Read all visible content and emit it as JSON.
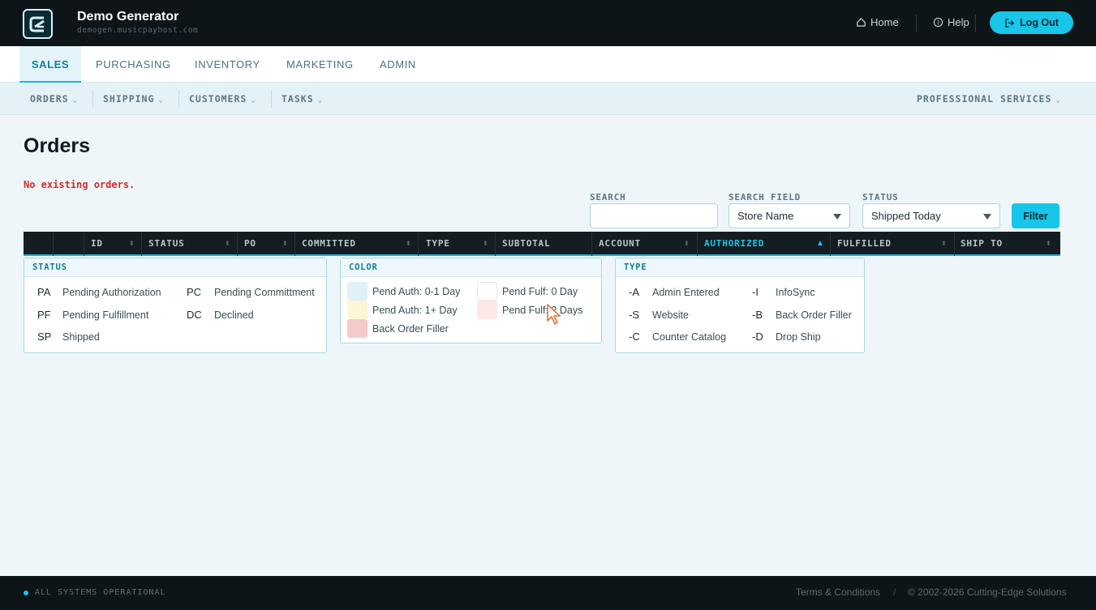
{
  "app": {
    "title": "Demo Generator",
    "subtitle": "demogen.musicpayhost.com"
  },
  "header": {
    "home_label": "Home",
    "help_label": "Help",
    "logout_label": "Log Out"
  },
  "main_tabs": [
    {
      "label": "SALES",
      "active": true
    },
    {
      "label": "PURCHASING",
      "active": false
    },
    {
      "label": "INVENTORY",
      "active": false
    },
    {
      "label": "MARKETING",
      "active": false
    },
    {
      "label": "ADMIN",
      "active": false
    }
  ],
  "sub_nav": {
    "items": [
      "ORDERS",
      "SHIPPING",
      "CUSTOMERS",
      "TASKS"
    ],
    "right_item": "PROFESSIONAL SERVICES"
  },
  "page": {
    "title": "Orders",
    "empty_message": "No existing orders."
  },
  "filters": {
    "search_label": "SEARCH",
    "search_value": "",
    "search_field_label": "SEARCH FIELD",
    "search_field_value": "Store Name",
    "status_label": "STATUS",
    "status_value": "Shipped Today",
    "filter_button": "Filter"
  },
  "table": {
    "columns": [
      "ID",
      "STATUS",
      "PO",
      "COMMITTED",
      "TYPE",
      "SUBTOTAL",
      "ACCOUNT",
      "AUTHORIZED",
      "FULFILLED",
      "SHIP TO"
    ],
    "sorted_column": "AUTHORIZED",
    "sort_direction": "asc"
  },
  "legend": {
    "status": {
      "title": "STATUS",
      "items": [
        {
          "code": "PA",
          "label": "Pending Authorization"
        },
        {
          "code": "PC",
          "label": "Pending Committment"
        },
        {
          "code": "PF",
          "label": "Pending Fulfillment"
        },
        {
          "code": "DC",
          "label": "Declined"
        },
        {
          "code": "SP",
          "label": "Shipped"
        }
      ]
    },
    "color": {
      "title": "COLOR",
      "items": [
        {
          "label": "Pend Auth: 0-1 Day",
          "color": "#e1f0f7"
        },
        {
          "label": "Pend Fulf: 0 Day",
          "color": "#ffffff"
        },
        {
          "label": "Pend Auth: 1+ Day",
          "color": "#fcf6d7"
        },
        {
          "label": "Pend Fulf: 2 Days",
          "color": "#fde7e7"
        },
        {
          "label": "Back Order Filler",
          "color": "#f5caca"
        }
      ]
    },
    "type": {
      "title": "TYPE",
      "items": [
        {
          "code": "-A",
          "label": "Admin Entered"
        },
        {
          "code": "-I",
          "label": "InfoSync"
        },
        {
          "code": "-S",
          "label": "Website"
        },
        {
          "code": "-B",
          "label": "Back Order Filler"
        },
        {
          "code": "-C",
          "label": "Counter Catalog"
        },
        {
          "code": "-D",
          "label": "Drop Ship"
        }
      ]
    }
  },
  "footer": {
    "status": "ALL SYSTEMS OPERATIONAL",
    "terms": "Terms & Conditions",
    "separator": "/",
    "copyright": "© 2002-2026 Cutting-Edge Solutions"
  },
  "colors": {
    "accent": "#17c6e8",
    "header_bg": "#0e1518",
    "error": "#d22a2a"
  }
}
